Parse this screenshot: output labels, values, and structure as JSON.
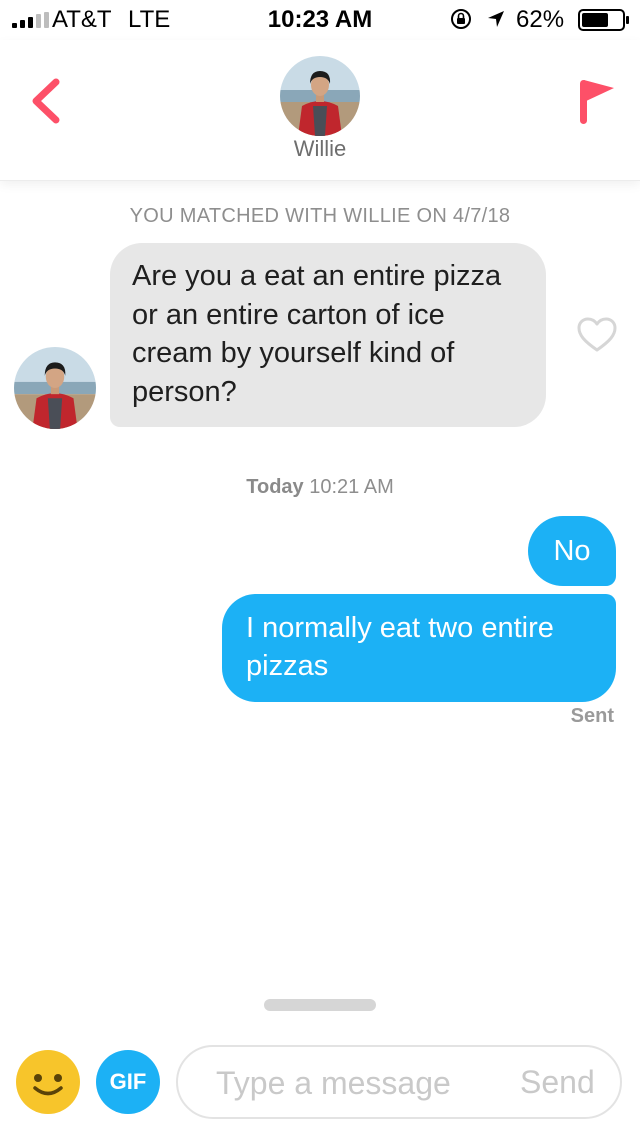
{
  "status_bar": {
    "carrier": "AT&T",
    "network": "LTE",
    "time": "10:23 AM",
    "battery_percent": "62%",
    "icons": [
      "signal-icon",
      "rotation-lock-icon",
      "location-icon",
      "battery-icon"
    ]
  },
  "header": {
    "contact_name": "Willie",
    "icons": [
      "back-chevron-icon",
      "report-flag-icon"
    ]
  },
  "conversation": {
    "match_note": "YOU MATCHED WITH WILLIE ON 4/7/18",
    "incoming_message": "Are you a eat an entire pizza or an entire carton of ice cream by yourself kind of person?",
    "timestamp_day": "Today",
    "timestamp_time": "10:21 AM",
    "outgoing_messages": [
      "No",
      "I normally eat two entire pizzas"
    ],
    "delivery_status": "Sent"
  },
  "composer": {
    "gif_label": "GIF",
    "input_placeholder": "Type a message",
    "send_label": "Send"
  },
  "colors": {
    "accent_red": "#fd5068",
    "outgoing_bubble": "#1cb1f5",
    "incoming_bubble": "#e7e7e7",
    "emoji_yellow": "#f7c52b"
  }
}
